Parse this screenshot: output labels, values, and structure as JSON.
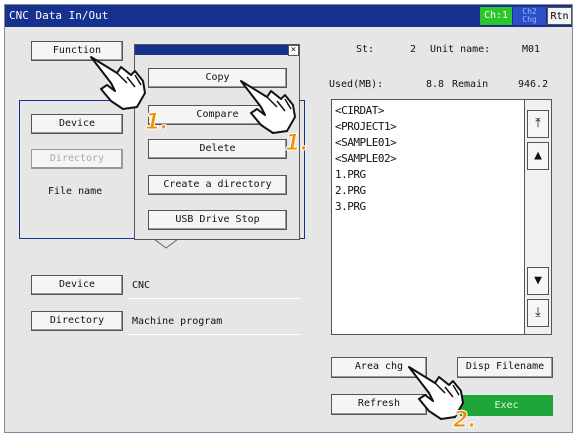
{
  "header": {
    "title": "CNC Data In/Out",
    "channel": "Ch:1",
    "chg_line1": "Ch2",
    "chg_line2": "Chg",
    "return": "Rtn"
  },
  "left": {
    "function_label": "Function",
    "source": {
      "device_label": "Device",
      "directory_label": "Directory",
      "file_name_label": "File name"
    },
    "destination": {
      "device_label": "Device",
      "device_value": "CNC",
      "directory_label": "Directory",
      "directory_value": "Machine program"
    }
  },
  "popup": {
    "close": "×",
    "items": [
      "Copy",
      "Compare",
      "Delete",
      "Create a directory",
      "USB Drive Stop"
    ]
  },
  "status": {
    "st_label": "St:",
    "st_value": "2",
    "unit_label": "Unit name:",
    "unit_value": "M01",
    "used_label": "Used(MB):",
    "used_value": "8.8",
    "remain_label": "Remain",
    "remain_value": "946.2"
  },
  "files": [
    "<CIRDAT>",
    "<PROJECT1>",
    "<SAMPLE01>",
    "<SAMPLE02>",
    "1.PRG",
    "2.PRG",
    "3.PRG"
  ],
  "scroll": {
    "top": "⤒",
    "up": "▲",
    "down": "▼",
    "bottom": "⤓"
  },
  "bottom": {
    "area_chg": "Area chg",
    "disp_filename": "Disp Filename",
    "refresh": "Refresh",
    "exec": "Exec"
  },
  "steps": {
    "one": "1.",
    "two": "2."
  },
  "colors": {
    "titlebar": "#17318f",
    "channel": "#2cc62c",
    "exec": "#1fa63b",
    "step": "#f28c00",
    "panel": "#e6e6e6"
  }
}
